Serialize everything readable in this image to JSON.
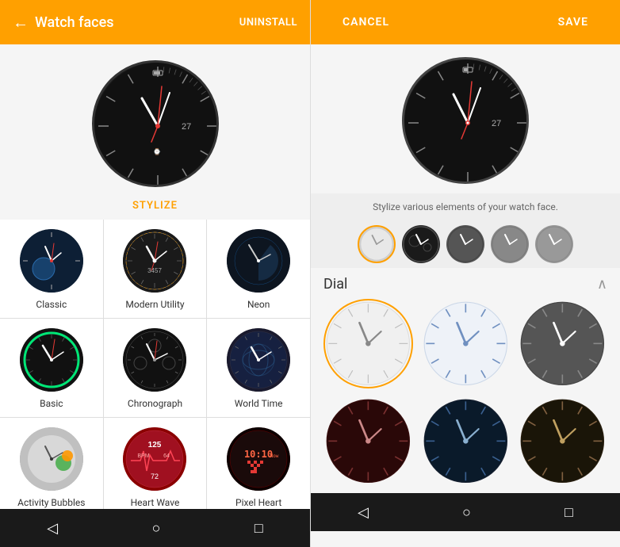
{
  "left": {
    "topbar": {
      "title": "Watch faces",
      "uninstall": "UNINSTALL",
      "back_arrow": "←"
    },
    "stylize_label": "STYLIZE",
    "watch_faces": [
      {
        "id": "classic",
        "label": "Classic",
        "style": "classic"
      },
      {
        "id": "modern-utility",
        "label": "Modern Utility",
        "style": "modern"
      },
      {
        "id": "neon",
        "label": "Neon",
        "style": "neon"
      },
      {
        "id": "basic",
        "label": "Basic",
        "style": "basic"
      },
      {
        "id": "chronograph",
        "label": "Chronograph",
        "style": "chrono"
      },
      {
        "id": "world-time",
        "label": "World Time",
        "style": "world"
      },
      {
        "id": "activity-bubbles",
        "label": "Activity Bubbles",
        "style": "activity"
      },
      {
        "id": "heart-wave",
        "label": "Heart Wave",
        "style": "heart"
      },
      {
        "id": "pixel-heart",
        "label": "Pixel Heart",
        "style": "pixel"
      }
    ],
    "nav": {
      "back": "◁",
      "home": "○",
      "recent": "□"
    }
  },
  "right": {
    "topbar": {
      "cancel": "CANCEL",
      "save": "SAVE"
    },
    "stylize_hint": "Stylize various elements of your watch face.",
    "dial_section": {
      "title": "Dial",
      "chevron": "∧"
    },
    "style_options": [
      {
        "id": "style-1",
        "color": "#d0d0d0"
      },
      {
        "id": "style-2",
        "color": "#c8c8a0"
      },
      {
        "id": "style-3",
        "color": "#555"
      },
      {
        "id": "style-4",
        "color": "#888"
      },
      {
        "id": "style-5",
        "color": "#999"
      }
    ],
    "dial_options_row1": [
      {
        "id": "dial-white",
        "bg": "#e8e8e8",
        "accent": "#ccc"
      },
      {
        "id": "dial-blue-white",
        "bg": "#e8eef5",
        "accent": "#b0c0d0"
      },
      {
        "id": "dial-dark",
        "bg": "#555",
        "accent": "#444"
      }
    ],
    "dial_options_row2": [
      {
        "id": "dial-dark-red",
        "bg": "#3a1010",
        "accent": "#5a2020"
      },
      {
        "id": "dial-dark-blue",
        "bg": "#1a2a3a",
        "accent": "#2a3a4a"
      },
      {
        "id": "dial-dark-gold",
        "bg": "#2a2010",
        "accent": "#4a3a20"
      }
    ],
    "nav": {
      "back": "◁",
      "home": "○",
      "recent": "□"
    }
  }
}
